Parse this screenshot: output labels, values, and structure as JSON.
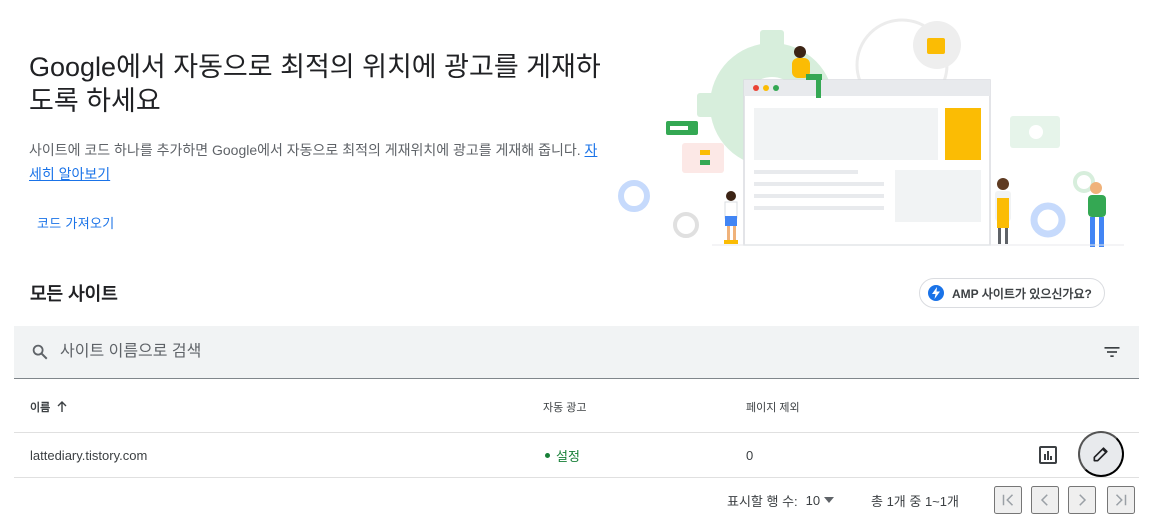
{
  "hero": {
    "title": "Google에서 자동으로 최적의 위치에 광고를 게재하도록 하세요",
    "description": "사이트에 코드 하나를 추가하면 Google에서 자동으로 최적의 게재위치에 광고를 게재해 줍니다. ",
    "learn_more": "자세히 알아보기",
    "import_code": "코드 가져오기"
  },
  "sites": {
    "title": "모든 사이트",
    "amp_chip": "AMP 사이트가 있으신가요?",
    "search_placeholder": "사이트 이름으로 검색"
  },
  "table": {
    "headers": {
      "name": "이름",
      "auto_ads": "자동 광고",
      "page_exclusions": "페이지 제외"
    },
    "rows": [
      {
        "name": "lattediary.tistory.com",
        "auto_ads": "설정",
        "page_exclusions": "0"
      }
    ]
  },
  "pagination": {
    "rows_label": "표시할 행 수:",
    "rows_value": "10",
    "count_text": "총 1개 중 1~1개"
  },
  "colors": {
    "accent": "#1a73e8",
    "status_on": "#188038",
    "search_bg": "#f1f3f4"
  },
  "icons": [
    "search-icon",
    "filter-icon",
    "sort-arrow-up-icon",
    "report-icon",
    "edit-icon",
    "bolt-icon",
    "first-page-icon",
    "prev-page-icon",
    "next-page-icon",
    "last-page-icon",
    "dropdown-arrow-icon"
  ]
}
